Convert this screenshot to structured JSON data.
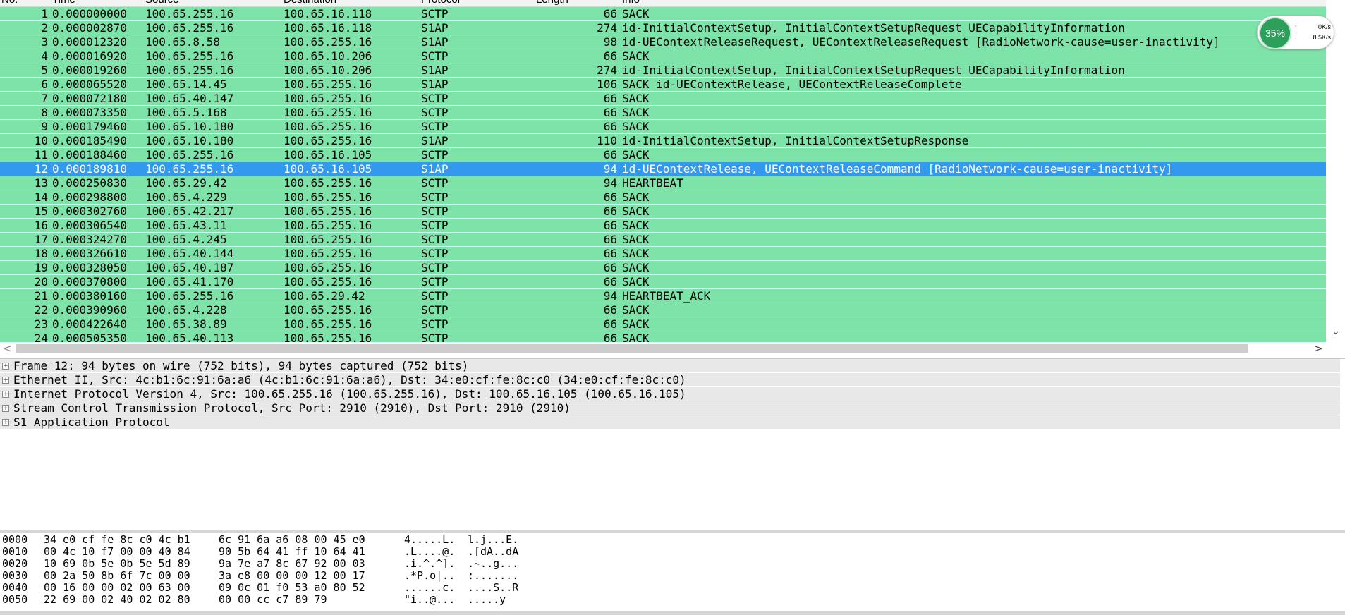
{
  "columns": {
    "no": "No.",
    "time": "Time",
    "source": "Source",
    "destination": "Destination",
    "protocol": "Protocol",
    "length": "Length",
    "info": "Info"
  },
  "packets": [
    {
      "no": "1",
      "time": "0.000000000",
      "src": "100.65.255.16",
      "dst": "100.65.16.118",
      "proto": "SCTP",
      "len": "66",
      "info": "SACK"
    },
    {
      "no": "2",
      "time": "0.000002870",
      "src": "100.65.255.16",
      "dst": "100.65.16.118",
      "proto": "S1AP",
      "len": "274",
      "info": "id-InitialContextSetup, InitialContextSetupRequest UECapabilityInformation"
    },
    {
      "no": "3",
      "time": "0.000012320",
      "src": "100.65.8.58",
      "dst": "100.65.255.16",
      "proto": "S1AP",
      "len": "98",
      "info": "id-UEContextReleaseRequest, UEContextReleaseRequest  [RadioNetwork-cause=user-inactivity]"
    },
    {
      "no": "4",
      "time": "0.000016920",
      "src": "100.65.255.16",
      "dst": "100.65.10.206",
      "proto": "SCTP",
      "len": "66",
      "info": "SACK"
    },
    {
      "no": "5",
      "time": "0.000019260",
      "src": "100.65.255.16",
      "dst": "100.65.10.206",
      "proto": "S1AP",
      "len": "274",
      "info": "id-InitialContextSetup, InitialContextSetupRequest UECapabilityInformation"
    },
    {
      "no": "6",
      "time": "0.000065520",
      "src": "100.65.14.45",
      "dst": "100.65.255.16",
      "proto": "S1AP",
      "len": "106",
      "info": "SACK id-UEContextRelease, UEContextReleaseComplete"
    },
    {
      "no": "7",
      "time": "0.000072180",
      "src": "100.65.40.147",
      "dst": "100.65.255.16",
      "proto": "SCTP",
      "len": "66",
      "info": "SACK"
    },
    {
      "no": "8",
      "time": "0.000073350",
      "src": "100.65.5.168",
      "dst": "100.65.255.16",
      "proto": "SCTP",
      "len": "66",
      "info": "SACK"
    },
    {
      "no": "9",
      "time": "0.000179460",
      "src": "100.65.10.180",
      "dst": "100.65.255.16",
      "proto": "SCTP",
      "len": "66",
      "info": "SACK"
    },
    {
      "no": "10",
      "time": "0.000185490",
      "src": "100.65.10.180",
      "dst": "100.65.255.16",
      "proto": "S1AP",
      "len": "110",
      "info": "id-InitialContextSetup, InitialContextSetupResponse"
    },
    {
      "no": "11",
      "time": "0.000188460",
      "src": "100.65.255.16",
      "dst": "100.65.16.105",
      "proto": "SCTP",
      "len": "66",
      "info": "SACK"
    },
    {
      "no": "12",
      "time": "0.000189810",
      "src": "100.65.255.16",
      "dst": "100.65.16.105",
      "proto": "S1AP",
      "len": "94",
      "info": "id-UEContextRelease, UEContextReleaseCommand  [RadioNetwork-cause=user-inactivity]",
      "selected": true
    },
    {
      "no": "13",
      "time": "0.000250830",
      "src": "100.65.29.42",
      "dst": "100.65.255.16",
      "proto": "SCTP",
      "len": "94",
      "info": "HEARTBEAT"
    },
    {
      "no": "14",
      "time": "0.000298800",
      "src": "100.65.4.229",
      "dst": "100.65.255.16",
      "proto": "SCTP",
      "len": "66",
      "info": "SACK"
    },
    {
      "no": "15",
      "time": "0.000302760",
      "src": "100.65.42.217",
      "dst": "100.65.255.16",
      "proto": "SCTP",
      "len": "66",
      "info": "SACK"
    },
    {
      "no": "16",
      "time": "0.000306540",
      "src": "100.65.43.11",
      "dst": "100.65.255.16",
      "proto": "SCTP",
      "len": "66",
      "info": "SACK"
    },
    {
      "no": "17",
      "time": "0.000324270",
      "src": "100.65.4.245",
      "dst": "100.65.255.16",
      "proto": "SCTP",
      "len": "66",
      "info": "SACK"
    },
    {
      "no": "18",
      "time": "0.000326610",
      "src": "100.65.40.144",
      "dst": "100.65.255.16",
      "proto": "SCTP",
      "len": "66",
      "info": "SACK"
    },
    {
      "no": "19",
      "time": "0.000328050",
      "src": "100.65.40.187",
      "dst": "100.65.255.16",
      "proto": "SCTP",
      "len": "66",
      "info": "SACK"
    },
    {
      "no": "20",
      "time": "0.000370800",
      "src": "100.65.41.170",
      "dst": "100.65.255.16",
      "proto": "SCTP",
      "len": "66",
      "info": "SACK"
    },
    {
      "no": "21",
      "time": "0.000380160",
      "src": "100.65.255.16",
      "dst": "100.65.29.42",
      "proto": "SCTP",
      "len": "94",
      "info": "HEARTBEAT_ACK"
    },
    {
      "no": "22",
      "time": "0.000390960",
      "src": "100.65.4.228",
      "dst": "100.65.255.16",
      "proto": "SCTP",
      "len": "66",
      "info": "SACK"
    },
    {
      "no": "23",
      "time": "0.000422640",
      "src": "100.65.38.89",
      "dst": "100.65.255.16",
      "proto": "SCTP",
      "len": "66",
      "info": "SACK"
    },
    {
      "no": "24",
      "time": "0.000505350",
      "src": "100.65.40.113",
      "dst": "100.65.255.16",
      "proto": "SCTP",
      "len": "66",
      "info": "SACK"
    }
  ],
  "details": [
    "Frame 12: 94 bytes on wire (752 bits), 94 bytes captured (752 bits)",
    "Ethernet II, Src: 4c:b1:6c:91:6a:a6 (4c:b1:6c:91:6a:a6), Dst: 34:e0:cf:fe:8c:c0 (34:e0:cf:fe:8c:c0)",
    "Internet Protocol Version 4, Src: 100.65.255.16 (100.65.255.16), Dst: 100.65.16.105 (100.65.16.105)",
    "Stream Control Transmission Protocol, Src Port: 2910 (2910), Dst Port: 2910 (2910)",
    "S1 Application Protocol"
  ],
  "details_expander_glyph": "⊞",
  "hex": [
    {
      "offset": "0000",
      "b1": "34 e0 cf fe 8c c0 4c b1",
      "b2": "6c 91 6a a6 08 00 45 e0",
      "a1": "4.....L.",
      "a2": "l.j...E."
    },
    {
      "offset": "0010",
      "b1": "00 4c 10 f7 00 00 40 84",
      "b2": "90 5b 64 41 ff 10 64 41",
      "a1": ".L....@.",
      ".a2": "",
      "a2": ".[dA..dA"
    },
    {
      "offset": "0020",
      "b1": "10 69 0b 5e 0b 5e 5d 89",
      "b2": "9a 7e a7 8c 67 92 00 03",
      "a1": ".i.^.^].",
      "a2": ".~..g..."
    },
    {
      "offset": "0030",
      "b1": "00 2a 50 8b 6f 7c 00 00",
      "b2": "3a e8 00 00 00 12 00 17",
      "a1": ".*P.o|..",
      "a2": ":......."
    },
    {
      "offset": "0040",
      "b1": "00 16 00 00 02 00 63 00",
      "b2": "09 0c 01 f0 53 a0 80 52",
      "a1": "......c.",
      "a2": "....S..R"
    },
    {
      "offset": "0050",
      "b1": "22 69 00 02 40 02 02 80",
      "b2": "00 00 cc c7 89 79",
      "a1": "\"i..@...",
      "a2": ".....y"
    }
  ],
  "net_widget": {
    "percent": "35%",
    "up_arrow": "↑",
    "up_speed": "0K/s",
    "down_arrow": "↓",
    "down_speed": "8.5K/s"
  },
  "scroll_icons": {
    "down": "⌄",
    "left": "<",
    "right": ">"
  },
  "colors": {
    "row_green": "#7ee3a9",
    "row_selected": "#3399ee",
    "detail_row": "#e8e8e8"
  }
}
